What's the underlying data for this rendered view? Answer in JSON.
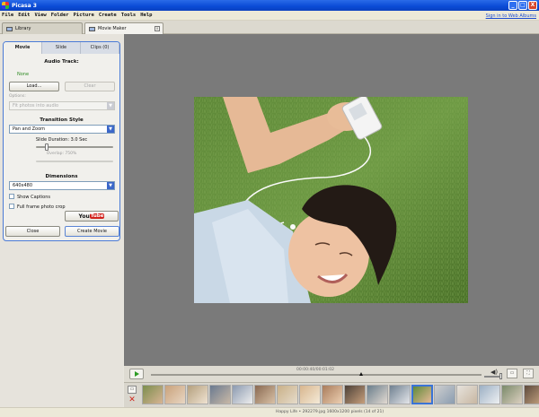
{
  "window": {
    "title": "Picasa 3",
    "minimize": "_",
    "maximize": "□",
    "close": "X"
  },
  "menu": {
    "items": [
      "File",
      "Edit",
      "View",
      "Folder",
      "Picture",
      "Create",
      "Tools",
      "Help"
    ],
    "sign_in": "Sign in to Web Albums"
  },
  "tabs": {
    "library": "Library",
    "movie_maker": "Movie Maker",
    "close": "x"
  },
  "panel": {
    "tabs": [
      "Movie",
      "Slide",
      "Clips (0)"
    ],
    "audio_title": "Audio Track:",
    "audio_value": "None",
    "load_button": "Load...",
    "clear_button": "Clear",
    "options_label": "Options:",
    "options_value": "Fit photos into audio",
    "transition_title": "Transition Style",
    "transition_value": "Pan and Zoom",
    "slide_duration_label": "Slide Duration: 3.0 Sec",
    "overlap_label": "Overlap: 750%",
    "slide_duration_fraction": 0.12,
    "dimensions_title": "Dimensions",
    "dimensions_value": "640x480",
    "show_captions": "Show Captions",
    "full_frame_crop": "Full frame photo crop",
    "dropdown_arrow": "▼"
  },
  "youtube": {
    "you": "You",
    "tube": "Tube"
  },
  "actions": {
    "close": "Close",
    "create_movie": "Create Movie"
  },
  "controls": {
    "time": "00:00:40/00:01:02",
    "volume_icon": "◀)",
    "icon_a": "▭",
    "icon_b": "⛶"
  },
  "strip": {
    "add_icon": "▭",
    "delete_icon": "✕"
  },
  "status": {
    "text": "Happy Life • 292279.jpg     1600x1200 pixels     (14 of 21)"
  },
  "colors": {
    "accent": "#3a73d6",
    "youtube_red": "#d2211b",
    "viewer_bg": "#7a7a7a",
    "grass": "#5f8a3a"
  }
}
